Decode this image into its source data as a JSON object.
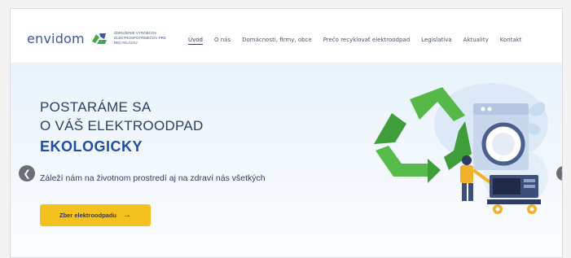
{
  "logo": {
    "word": "envidom",
    "tagline": "Združenie výrobcov elektrospotrebičov pre recykláciu",
    "brand_color": "#3a56a8",
    "mark_color": "#44a949"
  },
  "nav": {
    "items": [
      "Úvod",
      "O nás",
      "Domácnosti, firmy, obce",
      "Prečo recyklovať elektroodpad",
      "Legislatíva",
      "Aktuality",
      "Kontakt"
    ],
    "active_index": 0
  },
  "hero": {
    "line1": "POSTARÁME SA",
    "line2": "O VÁŠ ELEKTROODPAD",
    "line3": "EKOLOGICKY",
    "subtitle": "Záleží nám na životnom prostredí aj na zdraví nás všetkých",
    "cta_label": "Zber elektroodpadu",
    "cta_arrow": "→",
    "accent_color": "#1f4ea3",
    "cta_color": "#f3c21e"
  },
  "carousel": {
    "prev_icon": "chevron-left-icon",
    "next_icon": "chevron-right-icon",
    "prev_glyph": "❮",
    "next_glyph": "❯"
  }
}
